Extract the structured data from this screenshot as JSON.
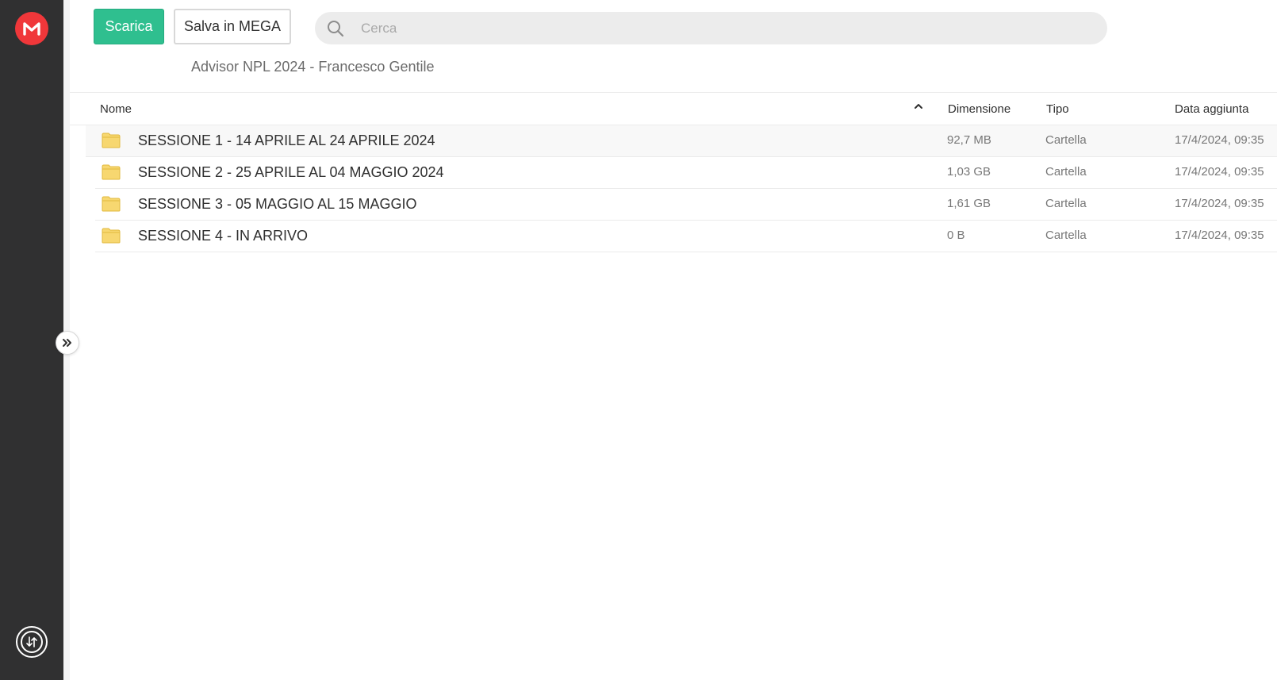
{
  "colors": {
    "sidebar": "#303031",
    "brand": "#f0373a",
    "primary_button": "#2fbf8f",
    "folder": "#f7d770"
  },
  "sidebar": {
    "logo_icon": "mega-logo-icon",
    "transfers_icon": "transfers-icon",
    "expand_icon": "double-chevron-right-icon"
  },
  "toolbar": {
    "download_label": "Scarica",
    "save_label": "Salva in MEGA"
  },
  "search": {
    "placeholder": "Cerca",
    "value": ""
  },
  "breadcrumb": "Advisor NPL 2024 - Francesco Gentile",
  "table": {
    "columns": {
      "name": "Nome",
      "size": "Dimensione",
      "type": "Tipo",
      "date": "Data aggiunta"
    },
    "sort": {
      "column": "name",
      "direction": "ascending",
      "icon": "chevron-up-icon"
    },
    "rows": [
      {
        "icon": "folder-icon",
        "name": "SESSIONE 1 - 14 APRILE AL 24 APRILE 2024",
        "size": "92,7 MB",
        "type": "Cartella",
        "date": "17/4/2024, 09:35"
      },
      {
        "icon": "folder-icon",
        "name": "SESSIONE 2 - 25 APRILE AL 04 MAGGIO 2024",
        "size": "1,03 GB",
        "type": "Cartella",
        "date": "17/4/2024, 09:35"
      },
      {
        "icon": "folder-icon",
        "name": "SESSIONE 3 - 05 MAGGIO AL 15 MAGGIO",
        "size": "1,61 GB",
        "type": "Cartella",
        "date": "17/4/2024, 09:35"
      },
      {
        "icon": "folder-icon",
        "name": "SESSIONE 4 - IN ARRIVO",
        "size": "0 B",
        "type": "Cartella",
        "date": "17/4/2024, 09:35"
      }
    ]
  }
}
